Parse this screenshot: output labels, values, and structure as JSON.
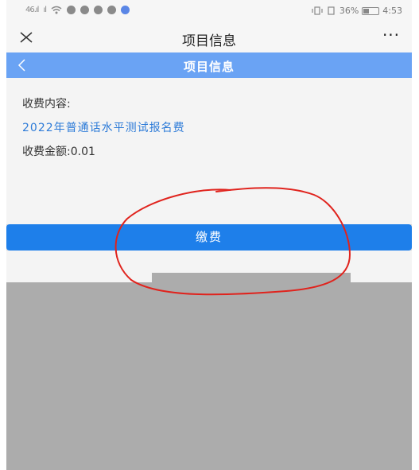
{
  "status_bar": {
    "left_signal_1": "46.ıl",
    "left_signal_2": "ıl",
    "battery_percent": "36%",
    "time": "4:53"
  },
  "title_bar": {
    "title": "项目信息",
    "more": "···"
  },
  "nav_header": {
    "back": "<",
    "title": "项目信息"
  },
  "content": {
    "label": "收费内容:",
    "fee_name": "2022年普通话水平测试报名费",
    "amount": "收费金额:0.01"
  },
  "pay_button": {
    "label": "缴费"
  },
  "colors": {
    "nav_blue": "#6aa3f4",
    "button_blue": "#1e7fea",
    "link_blue": "#2d7bd8",
    "annotation_red": "#e0231d"
  }
}
